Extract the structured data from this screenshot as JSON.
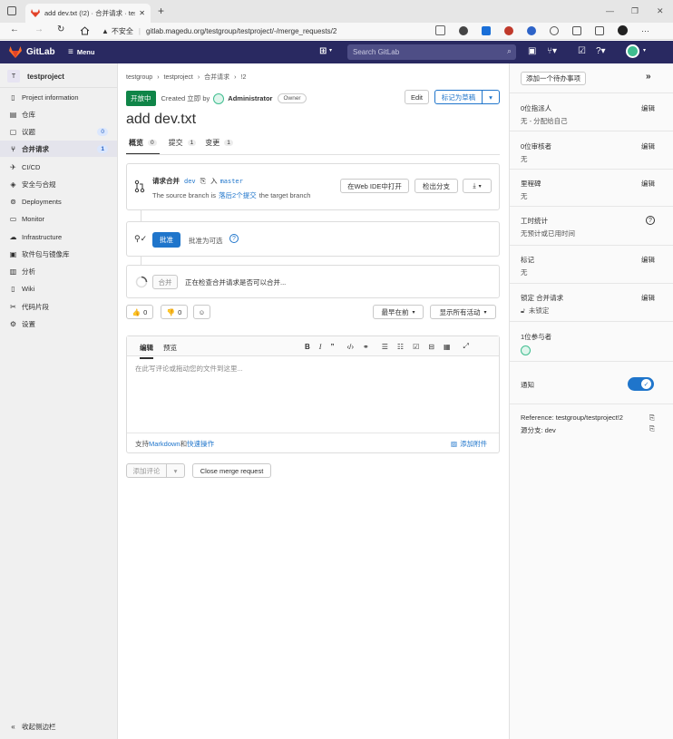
{
  "browser": {
    "tab_title": "add dev.txt (!2) · 合并请求 · testg",
    "close": "✕",
    "new_tab": "+",
    "security_label": "不安全",
    "url": "gitlab.magedu.org/testgroup/testproject/-/merge_requests/2"
  },
  "header": {
    "logo_text": "GitLab",
    "menu_label": "Menu",
    "search_placeholder": "Search GitLab"
  },
  "sidebar": {
    "project_initial": "T",
    "project_name": "testproject",
    "items": [
      {
        "label": "Project information",
        "icon": "info-icon"
      },
      {
        "label": "仓库",
        "icon": "doc-icon"
      },
      {
        "label": "议题",
        "icon": "issues-icon",
        "badge": "0"
      },
      {
        "label": "合并请求",
        "icon": "merge-request-icon",
        "badge": "1"
      },
      {
        "label": "CI/CD",
        "icon": "rocket-icon"
      },
      {
        "label": "安全与合规",
        "icon": "shield-icon"
      },
      {
        "label": "Deployments",
        "icon": "deploy-icon"
      },
      {
        "label": "Monitor",
        "icon": "monitor-icon"
      },
      {
        "label": "Infrastructure",
        "icon": "cloud-icon"
      },
      {
        "label": "软件包与镜像库",
        "icon": "package-icon"
      },
      {
        "label": "分析",
        "icon": "chart-icon"
      },
      {
        "label": "Wiki",
        "icon": "book-icon"
      },
      {
        "label": "代码片段",
        "icon": "scissors-icon"
      },
      {
        "label": "设置",
        "icon": "gear-icon"
      }
    ],
    "collapse_label": "收起侧边栏"
  },
  "breadcrumb": [
    "testgroup",
    "testproject",
    "合并请求",
    "!2"
  ],
  "mr": {
    "status": "开放中",
    "created_prefix": "Created 立即 by",
    "author": "Administrator",
    "author_role": "Owner",
    "edit_label": "Edit",
    "mark_draft_label": "标记为草稿",
    "title": "add dev.txt",
    "tabs": [
      {
        "label": "概览",
        "count": "0"
      },
      {
        "label": "提交",
        "count": "1"
      },
      {
        "label": "变更",
        "count": "1"
      }
    ]
  },
  "widget": {
    "request_merge_prefix": "请求合并",
    "source_branch": "dev",
    "into_label": "入",
    "target_branch": "master",
    "behind_prefix": "The source branch is",
    "behind_link": "落后2个提交",
    "behind_suffix": "the target branch",
    "open_web_ide": "在Web IDE中打开",
    "checkout_branch": "检出分支"
  },
  "approval": {
    "approve_label": "批准",
    "optional_text": "批准为可选"
  },
  "merge": {
    "merge_label": "合并",
    "checking_text": "正在检查合并请求是否可以合并..."
  },
  "reactions": {
    "thumbs_up_count": "0",
    "thumbs_down_count": "0",
    "sort_label": "最早在前",
    "filter_label": "显示所有活动"
  },
  "comment": {
    "tab_write": "编辑",
    "tab_preview": "预览",
    "placeholder": "在此写评论或拖动您的文件到这里...",
    "markdown_prefix": "支持",
    "markdown_link": "Markdown",
    "markdown_mid": "和",
    "quick_actions_link": "快速操作",
    "attach_label": "添加附件",
    "add_comment": "添加评论",
    "close_mr": "Close merge request"
  },
  "right_sidebar": {
    "add_todo": "添加一个待办事项",
    "edit_label": "编辑",
    "assignee_title": "0位指派人",
    "assignee_value": "无 - 分配给自己",
    "reviewer_title": "0位审核者",
    "reviewer_value": "无",
    "milestone_title": "里程碑",
    "milestone_value": "无",
    "time_title": "工时统计",
    "time_value": "无预计或已用时间",
    "labels_title": "标记",
    "labels_value": "无",
    "lock_title": "锁定 合并请求",
    "lock_value": "未锁定",
    "participants_title": "1位参与者",
    "notify_title": "通知",
    "reference_label": "Reference: testgroup/testproject!2",
    "source_branch_label": "源分支: dev"
  },
  "colors": {
    "header_bg": "#292961",
    "status_green": "#108548",
    "link_blue": "#1f75cb",
    "toggle_blue": "#1f75cb"
  }
}
